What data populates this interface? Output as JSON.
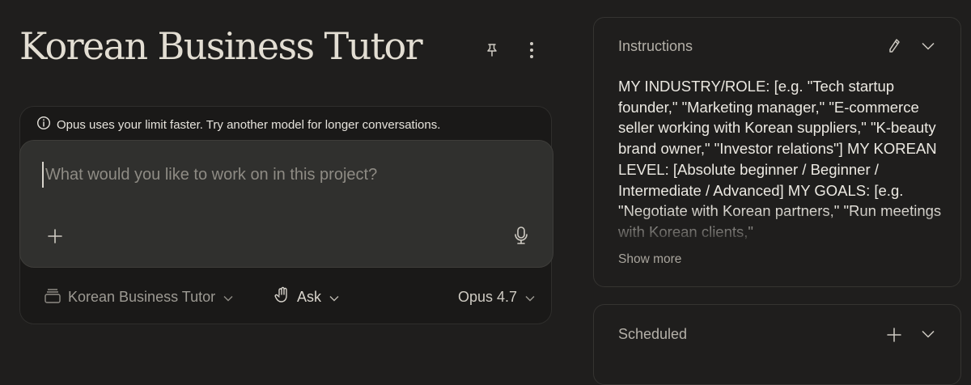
{
  "project": {
    "title": "Korean Business Tutor"
  },
  "header_icons": {
    "pin": "pin-icon",
    "more": "more-vertical-icon"
  },
  "composer": {
    "notice": "Opus uses your limit faster. Try another model for longer conversations.",
    "placeholder": "What would you like to work on in this project?",
    "project_selector": "Korean Business Tutor",
    "mode": "Ask",
    "model": "Opus 4.7"
  },
  "instructions": {
    "title": "Instructions",
    "text": "MY INDUSTRY/ROLE: [e.g. \"Tech startup founder,\" \"Marketing manager,\" \"E-commerce seller working with Korean suppliers,\" \"K-beauty brand owner,\" \"Investor relations\"]\nMY KOREAN LEVEL: [Absolute beginner / Beginner / Intermediate / Advanced]\nMY GOALS: [e.g. \"Negotiate with Korean partners,\" \"Run meetings with Korean clients,\"",
    "show_more": "Show more"
  },
  "scheduled": {
    "title": "Scheduled"
  },
  "colors": {
    "background": "#1f1e1d",
    "composer": "#30302e",
    "text": "#e8e5de",
    "muted": "#9d9a93"
  }
}
